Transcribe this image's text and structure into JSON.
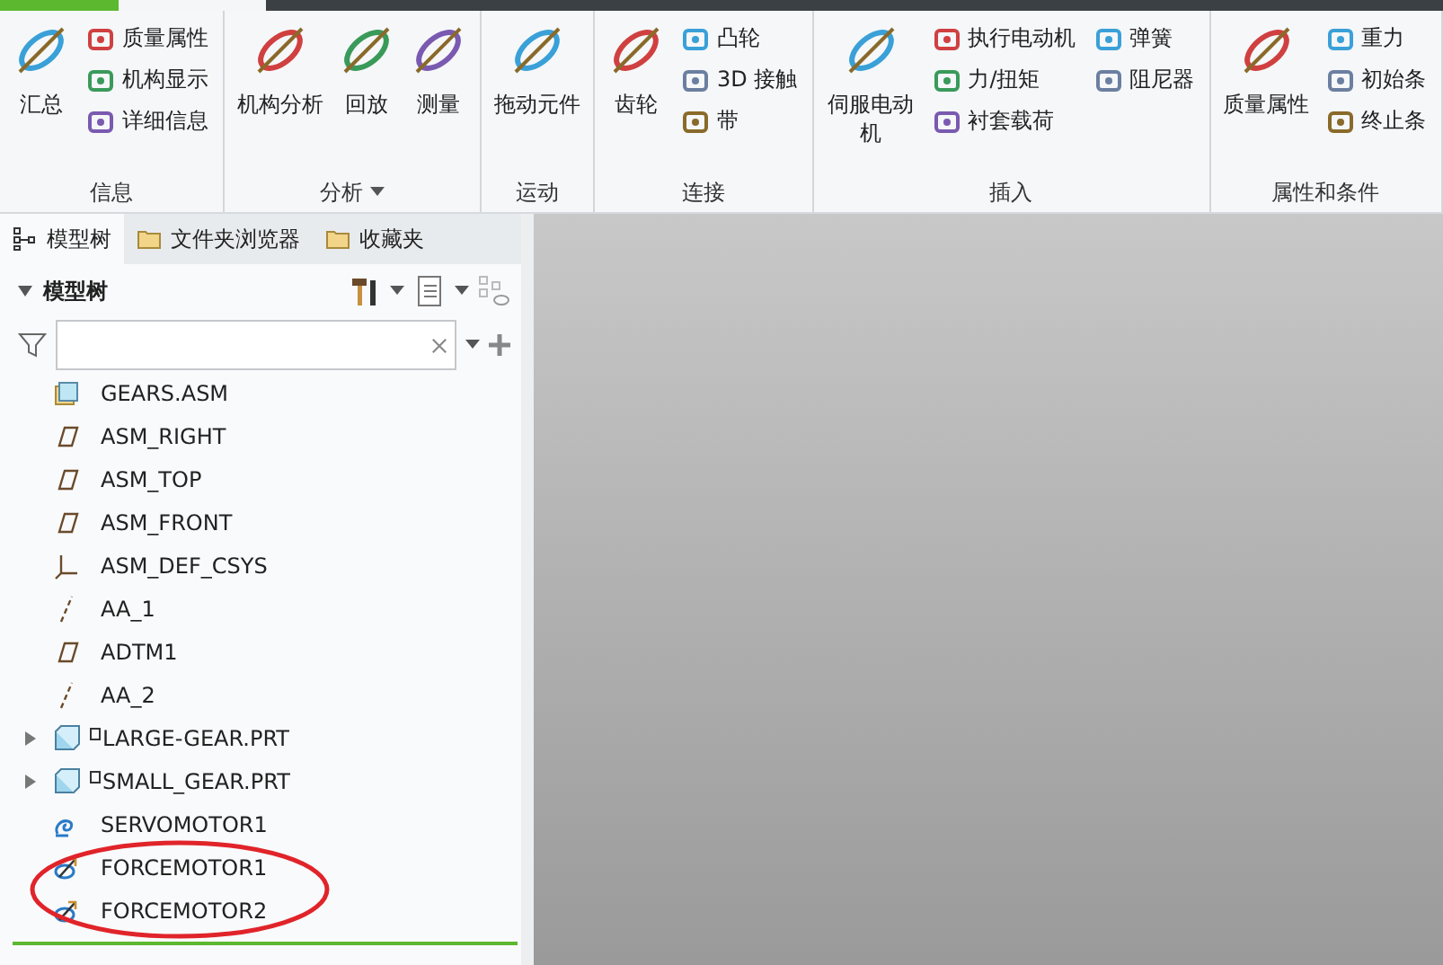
{
  "ribbon": {
    "groups": [
      {
        "label": "信息",
        "has_menu": false,
        "large": [
          {
            "label": "汇总"
          }
        ],
        "small_columns": [
          [
            {
              "label": "质量属性"
            },
            {
              "label": "机构显示"
            },
            {
              "label": "详细信息"
            }
          ]
        ]
      },
      {
        "label": "分析",
        "has_menu": true,
        "large": [
          {
            "label": "机构分析"
          },
          {
            "label": "回放"
          },
          {
            "label": "测量"
          }
        ]
      },
      {
        "label": "运动",
        "has_menu": false,
        "large": [
          {
            "label": "拖动元件"
          }
        ]
      },
      {
        "label": "连接",
        "has_menu": false,
        "large": [
          {
            "label": "齿轮"
          }
        ],
        "small_columns": [
          [
            {
              "label": "凸轮"
            },
            {
              "label": "3D 接触"
            },
            {
              "label": "带"
            }
          ]
        ]
      },
      {
        "label": "插入",
        "has_menu": false,
        "large": [
          {
            "label": "伺服电动机"
          }
        ],
        "small_columns": [
          [
            {
              "label": "执行电动机"
            },
            {
              "label": "力/扭矩"
            },
            {
              "label": "衬套载荷"
            }
          ],
          [
            {
              "label": "弹簧"
            },
            {
              "label": "阻尼器"
            }
          ]
        ]
      },
      {
        "label": "属性和条件",
        "has_menu": false,
        "large": [
          {
            "label": "质量属性"
          }
        ],
        "small_columns": [
          [
            {
              "label": "重力"
            },
            {
              "label": "初始条"
            },
            {
              "label": "终止条"
            }
          ]
        ]
      }
    ]
  },
  "panel_tabs": [
    {
      "label": "模型树",
      "selected": true
    },
    {
      "label": "文件夹浏览器",
      "selected": false
    },
    {
      "label": "收藏夹",
      "selected": false
    }
  ],
  "tree_header": {
    "title": "模型树",
    "expanded": true
  },
  "tree": [
    {
      "kind": "assembly",
      "label": "GEARS.ASM",
      "children": [
        {
          "kind": "plane",
          "label": "ASM_RIGHT"
        },
        {
          "kind": "plane",
          "label": "ASM_TOP"
        },
        {
          "kind": "plane",
          "label": "ASM_FRONT"
        },
        {
          "kind": "csys",
          "label": "ASM_DEF_CSYS"
        },
        {
          "kind": "axis",
          "label": "AA_1"
        },
        {
          "kind": "plane",
          "label": "ADTM1"
        },
        {
          "kind": "axis",
          "label": "AA_2"
        },
        {
          "kind": "part",
          "label": "LARGE-GEAR.PRT",
          "expanded": false
        },
        {
          "kind": "part",
          "label": "SMALL_GEAR.PRT",
          "expanded": false
        },
        {
          "kind": "servo",
          "label": "SERVOMOTOR1"
        },
        {
          "kind": "force",
          "label": "FORCEMOTOR1"
        },
        {
          "kind": "force",
          "label": "FORCEMOTOR2"
        }
      ]
    }
  ]
}
